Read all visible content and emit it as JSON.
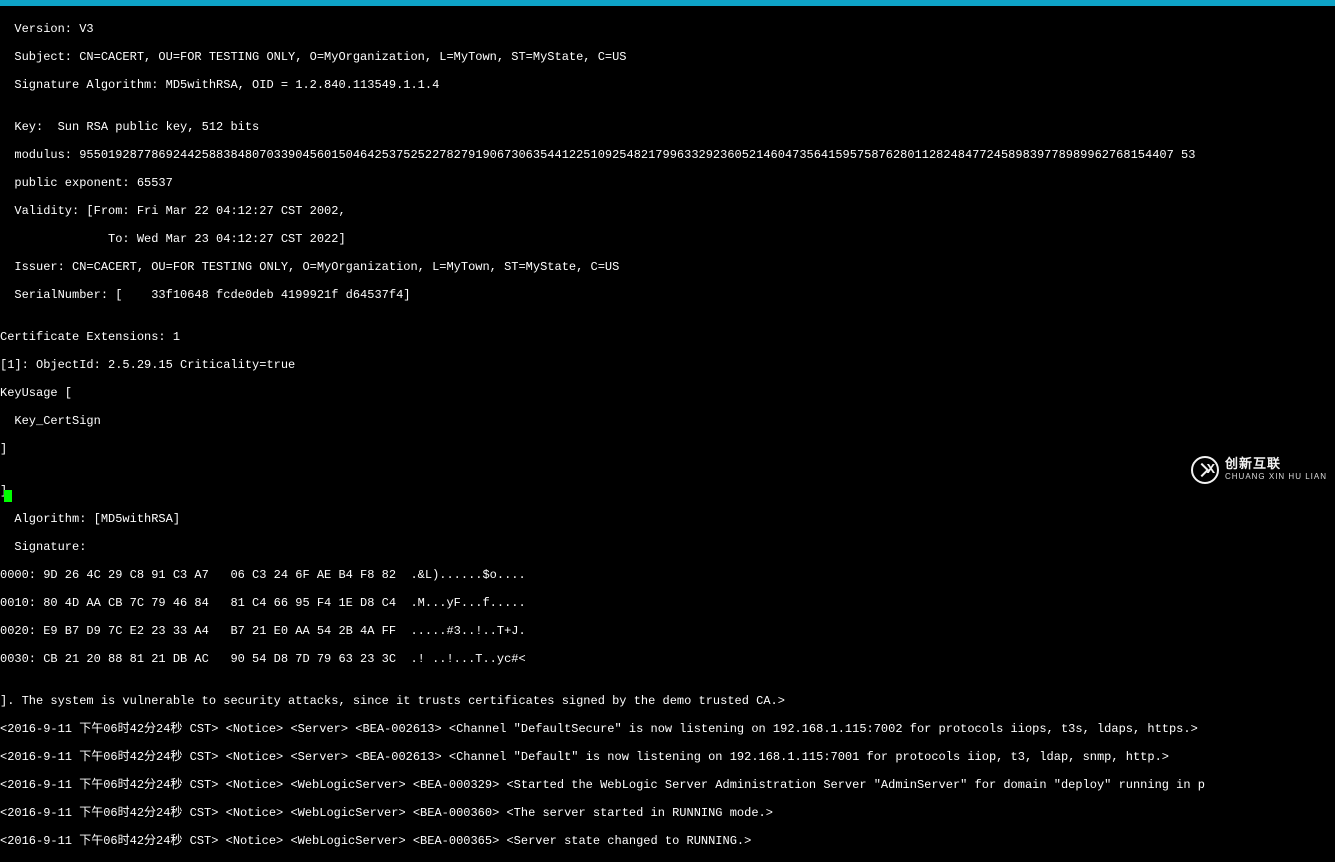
{
  "cert": {
    "version": "  Version: V3",
    "subject": "  Subject: CN=CACERT, OU=FOR TESTING ONLY, O=MyOrganization, L=MyTown, ST=MyState, C=US",
    "sigalg": "  Signature Algorithm: MD5withRSA, OID = 1.2.840.113549.1.1.4",
    "blank1": "",
    "key": "  Key:  Sun RSA public key, 512 bits",
    "modulus": "  modulus: 95501928778692442588384807033904560150464253752522782791906730635441225109254821799633292360521460473564159575876280112824847724589839778989962768154407 53",
    "pubexp": "  public exponent: 65537",
    "validity1": "  Validity: [From: Fri Mar 22 04:12:27 CST 2002,",
    "validity2": "               To: Wed Mar 23 04:12:27 CST 2022]",
    "issuer": "  Issuer: CN=CACERT, OU=FOR TESTING ONLY, O=MyOrganization, L=MyTown, ST=MyState, C=US",
    "serial": "  SerialNumber: [    33f10648 fcde0deb 4199921f d64537f4]",
    "blank2": "",
    "ext1": "Certificate Extensions: 1",
    "ext2": "[1]: ObjectId: 2.5.29.15 Criticality=true",
    "ext3": "KeyUsage [",
    "ext4": "  Key_CertSign",
    "ext5": "]",
    "blank3": "",
    "close": "]",
    "algo": "  Algorithm: [MD5withRSA]",
    "siglabel": "  Signature:",
    "sig0": "0000: 9D 26 4C 29 C8 91 C3 A7   06 C3 24 6F AE B4 F8 82  .&L)......$o....",
    "sig1": "0010: 80 4D AA CB 7C 79 46 84   81 C4 66 95 F4 1E D8 C4  .M...yF...f.....",
    "sig2": "0020: E9 B7 D9 7C E2 23 33 A4   B7 21 E0 AA 54 2B 4A FF  .....#3..!..T+J.",
    "sig3": "0030: CB 21 20 88 81 21 DB AC   90 54 D8 7D 79 63 23 3C  .! ..!...T..yc#<",
    "blank4": "",
    "warn": "]. The system is vulnerable to security attacks, since it trusts certificates signed by the demo trusted CA.>",
    "log1": "<2016-9-11 下午06时42分24秒 CST> <Notice> <Server> <BEA-002613> <Channel \"DefaultSecure\" is now listening on 192.168.1.115:7002 for protocols iiops, t3s, ldaps, https.>",
    "log2": "<2016-9-11 下午06时42分24秒 CST> <Notice> <Server> <BEA-002613> <Channel \"Default\" is now listening on 192.168.1.115:7001 for protocols iiop, t3, ldap, snmp, http.>",
    "log3": "<2016-9-11 下午06时42分24秒 CST> <Notice> <WebLogicServer> <BEA-000329> <Started the WebLogic Server Administration Server \"AdminServer\" for domain \"deploy\" running in p",
    "log4": "<2016-9-11 下午06时42分24秒 CST> <Notice> <WebLogicServer> <BEA-000360> <The server started in RUNNING mode.>",
    "log5": "<2016-9-11 下午06时42分24秒 CST> <Notice> <WebLogicServer> <BEA-000365> <Server state changed to RUNNING.>"
  },
  "watermark": {
    "main": "创新互联",
    "sub": "CHUANG XIN HU LIAN"
  }
}
